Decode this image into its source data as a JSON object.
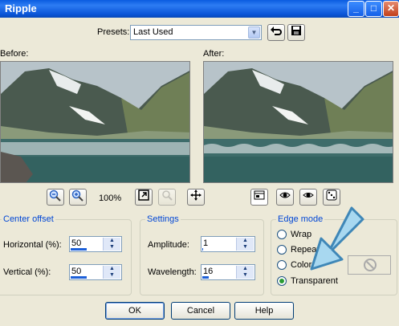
{
  "window": {
    "title": "Ripple"
  },
  "presets": {
    "label": "Presets:",
    "value": "Last Used"
  },
  "preview": {
    "before_label": "Before:",
    "after_label": "After:",
    "zoom": "100%"
  },
  "center_offset": {
    "title": "Center offset",
    "horizontal_label": "Horizontal (%):",
    "horizontal_value": "50",
    "horizontal_level": 0.5,
    "vertical_label": "Vertical (%):",
    "vertical_value": "50",
    "vertical_level": 0.5
  },
  "settings": {
    "title": "Settings",
    "amplitude_label": "Amplitude:",
    "amplitude_value": "1",
    "amplitude_level": 0.03,
    "wavelength_label": "Wavelength:",
    "wavelength_value": "16",
    "wavelength_level": 0.2
  },
  "edge_mode": {
    "title": "Edge mode",
    "options": [
      "Wrap",
      "Repeat",
      "Color",
      "Transparent"
    ],
    "selected": "Transparent"
  },
  "buttons": {
    "ok": "OK",
    "cancel": "Cancel",
    "help": "Help"
  },
  "colors": {
    "title_bar": "#0a5be0",
    "group_title": "#0046d5",
    "annotation_arrow": "#3f87b7"
  }
}
